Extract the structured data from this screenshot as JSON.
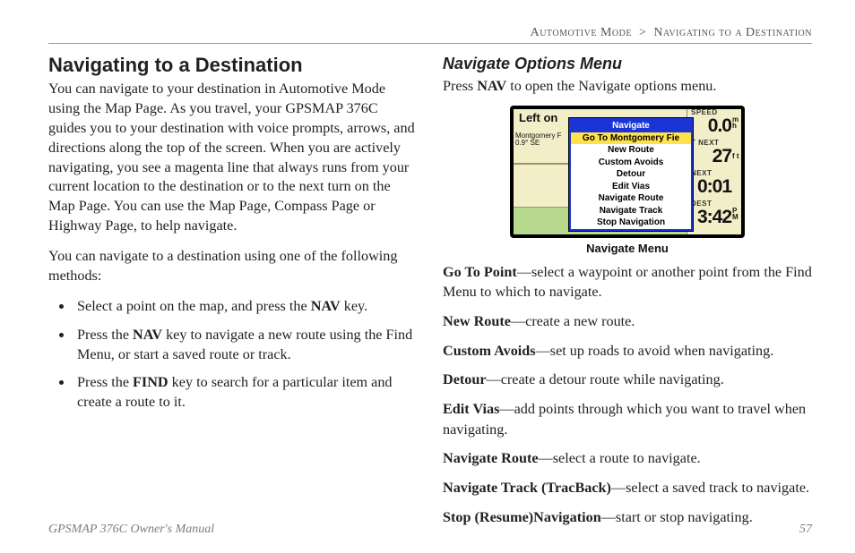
{
  "breadcrumb": {
    "section": "Automotive Mode",
    "sep": ">",
    "sub": "Navigating to a Destination"
  },
  "left": {
    "h1": "Navigating to a Destination",
    "p1": "You can navigate to your destination in Automotive Mode using the Map Page. As you travel, your GPSMAP 376C guides you to your destination with voice prompts, arrows, and directions along the top of the screen. When you are actively navigating, you see a magenta line that always runs from your current location to the destination or to the next turn on the Map Page. You can use the Map Page, Compass Page or Highway Page, to help navigate.",
    "p2": "You can navigate to a destination using one of the following methods:",
    "bullets": [
      {
        "pre": "Select a point on the map, and press the ",
        "bold": "NAV",
        "post": " key."
      },
      {
        "pre": "Press the ",
        "bold": "NAV",
        "post": " key to navigate a new route using the Find Menu, or start a saved route or track."
      },
      {
        "pre": "Press the ",
        "bold": "FIND",
        "post": " key to search for a particular item and create a route to it."
      }
    ]
  },
  "right": {
    "h2": "Navigate Options Menu",
    "intro": {
      "pre": "Press ",
      "bold": "NAV",
      "post": " to open the Navigate options menu."
    },
    "figure_caption": "Navigate Menu",
    "screen": {
      "top_text": "Left on",
      "side_label_top": "Montgomery F",
      "side_label_bot": "0.9°   SE",
      "popup_title": "Navigate",
      "menu": [
        {
          "label": "Go To Montgomery Fie",
          "selected": true
        },
        {
          "label": "New Route",
          "selected": false
        },
        {
          "label": "Custom Avoids",
          "selected": false
        },
        {
          "label": "Detour",
          "selected": false
        },
        {
          "label": "Edit Vias",
          "selected": false
        },
        {
          "label": "Navigate Route",
          "selected": false
        },
        {
          "label": "Navigate Track",
          "selected": false
        },
        {
          "label": "Stop Navigation",
          "selected": false
        }
      ],
      "right_panels": [
        {
          "cat": "SPEED",
          "val": "0.0",
          "unit": "m h"
        },
        {
          "cat": "T NEXT",
          "val": "27",
          "unit": "f t"
        },
        {
          "cat": "NEXT",
          "val": "0:01",
          "unit": ""
        },
        {
          "cat": "DEST",
          "val": "3:42",
          "unit": "P M"
        }
      ]
    },
    "definitions": [
      {
        "term": "Go To Point",
        "desc": "—select a waypoint or another point from the Find Menu to which to navigate."
      },
      {
        "term": "New Route",
        "desc": "—create a new route."
      },
      {
        "term": "Custom Avoids",
        "desc": "—set up roads to avoid when navigating."
      },
      {
        "term": "Detour",
        "desc": "—create a detour route while navigating."
      },
      {
        "term": "Edit Vias",
        "desc": "—add points through which you want to travel when navigating."
      },
      {
        "term": "Navigate Route",
        "desc": "—select a route to navigate."
      },
      {
        "term": "Navigate Track (TracBack)",
        "desc": "—select a saved track to navigate."
      },
      {
        "term": "Stop (Resume)Navigation",
        "desc": "—start or stop navigating."
      }
    ]
  },
  "footer": {
    "book": "GPSMAP 376C Owner's Manual",
    "page": "57"
  }
}
